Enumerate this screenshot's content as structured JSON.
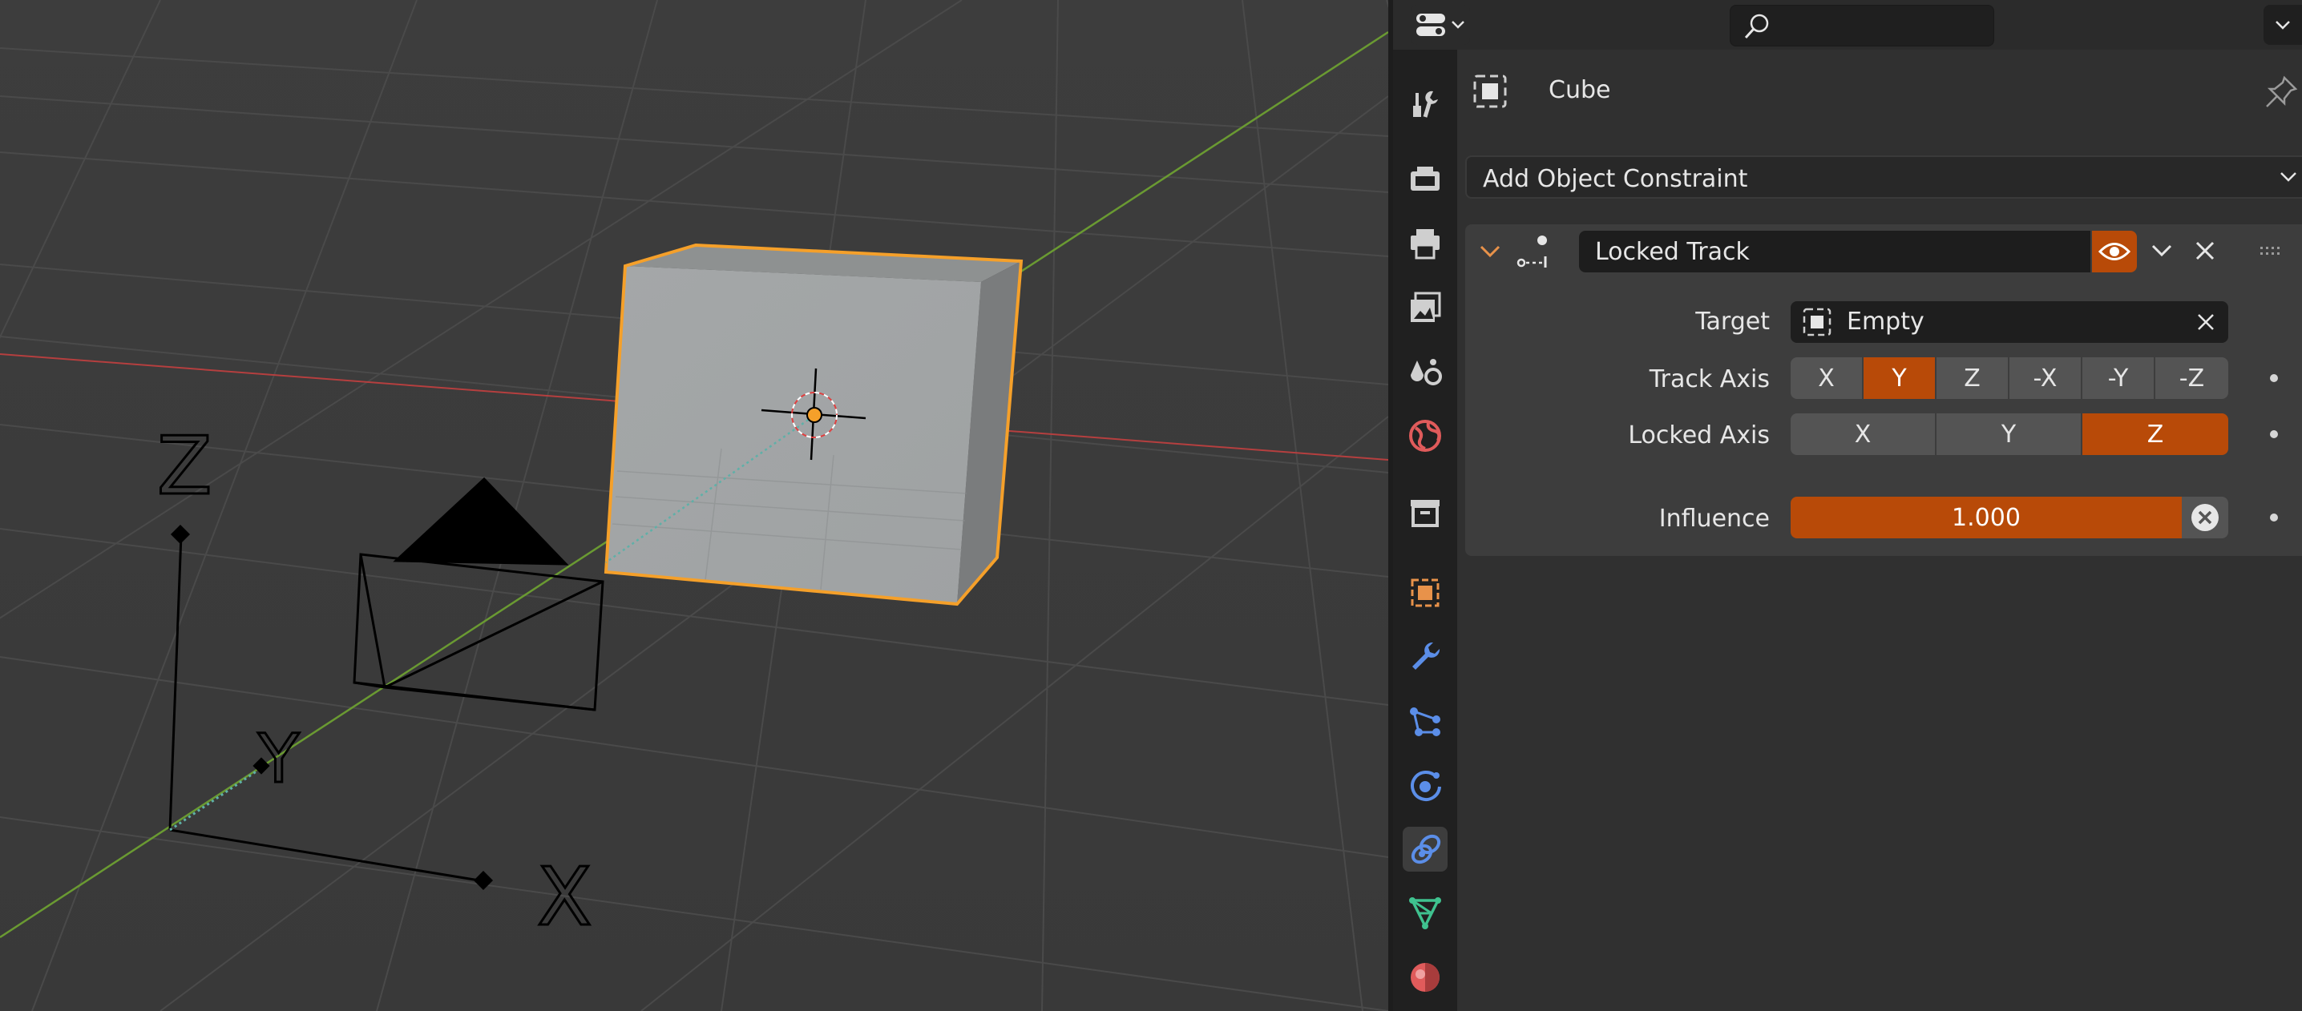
{
  "viewport": {
    "axis_labels": {
      "z": "Z",
      "y": "Y",
      "x": "X"
    }
  },
  "header": {
    "editor_type_icon": "properties-editor-icon",
    "search_placeholder": "",
    "menu_icon": "chevron-down-icon"
  },
  "tabs": [
    {
      "name": "tool",
      "icon": "wrench-screwdriver-icon",
      "color": "#cfcfcf",
      "active": false
    },
    {
      "name": "render",
      "icon": "camera-back-icon",
      "color": "#cfcfcf",
      "active": false
    },
    {
      "name": "output",
      "icon": "printer-icon",
      "color": "#cfcfcf",
      "active": false
    },
    {
      "name": "view-layer",
      "icon": "image-stack-icon",
      "color": "#cfcfcf",
      "active": false
    },
    {
      "name": "scene",
      "icon": "scene-drops-icon",
      "color": "#cfcfcf",
      "active": false
    },
    {
      "name": "world",
      "icon": "globe-icon",
      "color": "#e05b5b",
      "active": false
    },
    {
      "name": "collection",
      "icon": "box-archive-icon",
      "color": "#cfcfcf",
      "active": false
    },
    {
      "name": "object",
      "icon": "object-square-icon",
      "color": "#e8924a",
      "active": false
    },
    {
      "name": "modifiers",
      "icon": "wrench-icon",
      "color": "#5b8ee8",
      "active": false
    },
    {
      "name": "particles",
      "icon": "particles-icon",
      "color": "#5b8ee8",
      "active": false
    },
    {
      "name": "physics",
      "icon": "physics-orbit-icon",
      "color": "#5b8ee8",
      "active": false
    },
    {
      "name": "constraints",
      "icon": "constraint-link-icon",
      "color": "#5b8ee8",
      "active": true
    },
    {
      "name": "data",
      "icon": "mesh-triangle-icon",
      "color": "#3fc28f",
      "active": false
    },
    {
      "name": "material",
      "icon": "material-sphere-icon",
      "color": "#e05b5b",
      "active": false
    }
  ],
  "context": {
    "object_name": "Cube"
  },
  "add_constraint": {
    "label": "Add Object Constraint"
  },
  "constraint": {
    "name": "Locked Track",
    "target_label": "Target",
    "target_value": "Empty",
    "track_axis": {
      "label": "Track Axis",
      "options": [
        "X",
        "Y",
        "Z",
        "-X",
        "-Y",
        "-Z"
      ],
      "selected": "Y"
    },
    "locked_axis": {
      "label": "Locked Axis",
      "options": [
        "X",
        "Y",
        "Z"
      ],
      "selected": "Z"
    },
    "influence_label": "Influence",
    "influence_value": "1.000"
  },
  "colors": {
    "accent": "#b84a08",
    "selection_outline": "#f5a02a",
    "x_axis": "#b53f3f",
    "y_axis": "#6a9a32"
  }
}
